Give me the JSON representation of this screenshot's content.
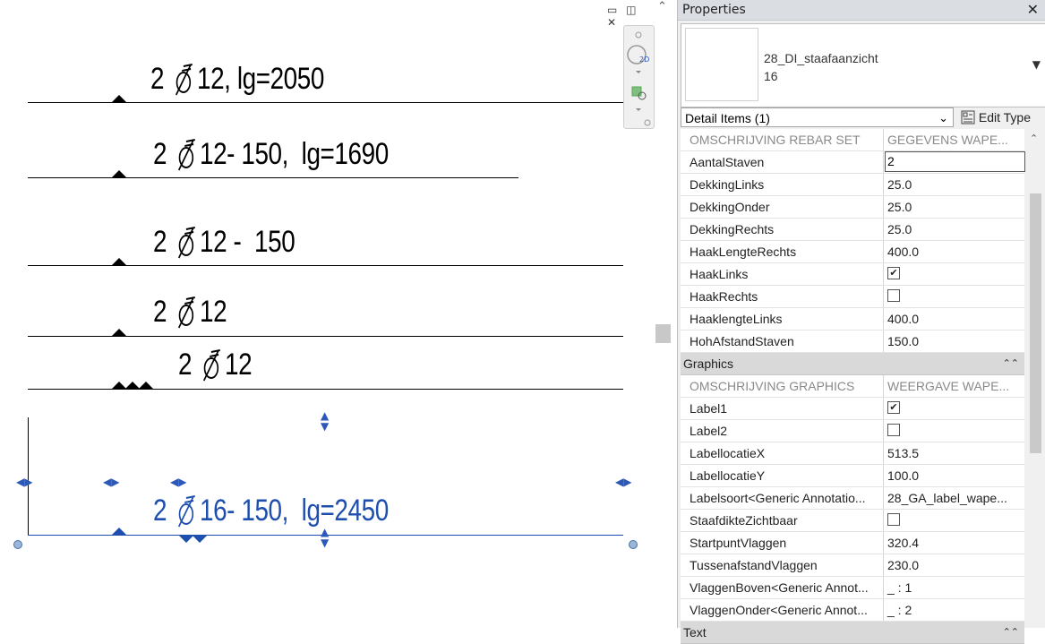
{
  "drawing": {
    "labels": [
      {
        "text": "12, lg=2050",
        "count": "2"
      },
      {
        "text": "12- 150,  lg=1690",
        "count": "2"
      },
      {
        "text": "12 -  150",
        "count": "2"
      },
      {
        "text": "12",
        "count": "2"
      },
      {
        "text": "12",
        "count": "2"
      },
      {
        "text": "16- 150,  lg=2450",
        "count": "2"
      }
    ],
    "window_buttons": "▭ ◫ ✕"
  },
  "properties": {
    "title": "Properties",
    "close": "✕",
    "type_name": "28_DI_staafaanzicht",
    "type_sub": "16",
    "filter": "Detail Items (1)",
    "edit_type": "Edit Type",
    "rows": [
      {
        "k": "OMSCHRIJVING REBAR SET",
        "v": "GEGEVENS WAPE..."
      },
      {
        "k": "AantalStaven",
        "v": "2"
      },
      {
        "k": "DekkingLinks",
        "v": "25.0"
      },
      {
        "k": "DekkingOnder",
        "v": "25.0"
      },
      {
        "k": "DekkingRechts",
        "v": "25.0"
      },
      {
        "k": "HaakLengteRechts",
        "v": "400.0"
      },
      {
        "k": "HaakLinks",
        "v": "✔"
      },
      {
        "k": "HaakRechts",
        "v": ""
      },
      {
        "k": "HaaklengteLinks",
        "v": "400.0"
      },
      {
        "k": "HohAfstandStaven",
        "v": "150.0"
      }
    ],
    "graphics_title": "Graphics",
    "graphics_rows": [
      {
        "k": "OMSCHRIJVING GRAPHICS",
        "v": "WEERGAVE WAPE..."
      },
      {
        "k": "Label1",
        "v": "✔"
      },
      {
        "k": "Label2",
        "v": ""
      },
      {
        "k": "LabellocatieX",
        "v": "513.5"
      },
      {
        "k": "LabellocatieY",
        "v": "100.0"
      },
      {
        "k": "Labelsoort<Generic Annotatio...",
        "v": "28_GA_label_wape..."
      },
      {
        "k": "StaafdikteZichtbaar",
        "v": ""
      },
      {
        "k": "StartpuntVlaggen",
        "v": "320.4"
      },
      {
        "k": "TussenafstandVlaggen",
        "v": "230.0"
      },
      {
        "k": "VlaggenBoven<Generic Annot...",
        "v": "_ : 1"
      },
      {
        "k": "VlaggenOnder<Generic Annot...",
        "v": "_ : 2"
      }
    ],
    "text_title": "Text"
  }
}
